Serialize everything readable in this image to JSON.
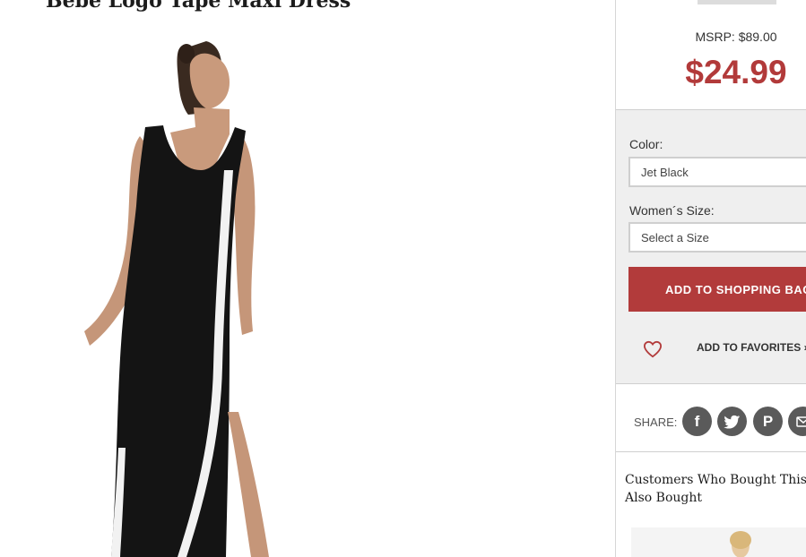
{
  "product": {
    "title": "Bebe Logo Tape Maxi Dress",
    "image_alt": "Model wearing black maxi dress with white side tape"
  },
  "pricing": {
    "msrp": "MSRP: $89.00",
    "price": "$24.99"
  },
  "options": {
    "color_label": "Color:",
    "color_value": "Jet Black",
    "size_label": "Women´s Size:",
    "size_placeholder": "Select a Size"
  },
  "actions": {
    "add_to_bag": "ADD TO SHOPPING BAG",
    "add_to_bag_icon": "chevron-right-icon",
    "add_to_favorites": "ADD TO FAVORITES ›",
    "favorite_icon": "heart-icon"
  },
  "share": {
    "label": "SHARE:",
    "networks": [
      "facebook",
      "twitter",
      "pinterest",
      "email"
    ]
  },
  "related": {
    "title_line1": "Customers Who Bought This It",
    "title_line2": "Also Bought"
  },
  "colors": {
    "accent": "#b23b3b",
    "price": "#b23a3a",
    "options_bg": "#efefef",
    "icon_gray": "#5a5a5a"
  }
}
